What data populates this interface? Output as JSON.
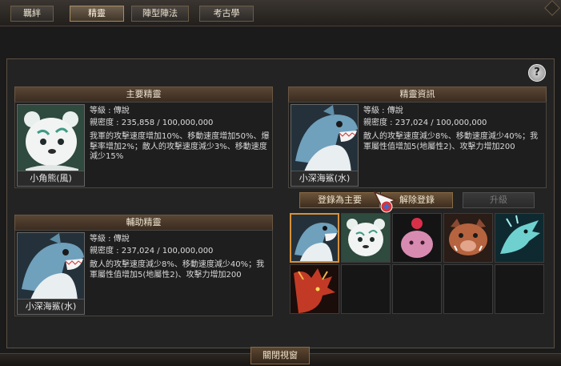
{
  "tabs": [
    {
      "label": "羈絆"
    },
    {
      "label": "精靈"
    },
    {
      "label": "陣型陣法"
    },
    {
      "label": "考古學"
    }
  ],
  "help_label": "?",
  "main_spirit": {
    "title": "主要精靈",
    "name": "小角熊(風)",
    "level_line": "等級 : 傳說",
    "intimacy_line": "親密度 : 235,858 / 100,000,000",
    "effect": "我軍的攻擊速度增加10%、移動速度增加50%、爆擊率增加2%；敵人的攻擊速度減少3%、移動速度減少15%"
  },
  "sub_spirit": {
    "title": "輔助精靈",
    "name": "小深海鯊(水)",
    "level_line": "等級 : 傳說",
    "intimacy_line": "親密度 : 237,024 / 100,000,000",
    "effect": "敵人的攻擊速度減少8%、移動速度減少40%；我軍屬性值增加5(地屬性2)、攻擊力增加200"
  },
  "spirit_info": {
    "title": "精靈資訊",
    "name": "小深海鯊(水)",
    "level_line": "等級 : 傳說",
    "intimacy_line": "親密度 : 237,024 / 100,000,000",
    "effect": "敵人的攻擊速度減少8%、移動速度減少40%；我軍屬性值增加5(地屬性2)、攻擊力增加200"
  },
  "buttons": {
    "register_main": "登錄為主要",
    "unregister": "解除登錄",
    "upgrade": "升級",
    "close": "關閉視窗"
  },
  "colors": {
    "accent": "#d7913a",
    "title_bg": "#4a3828",
    "text": "#dcdcdc"
  }
}
